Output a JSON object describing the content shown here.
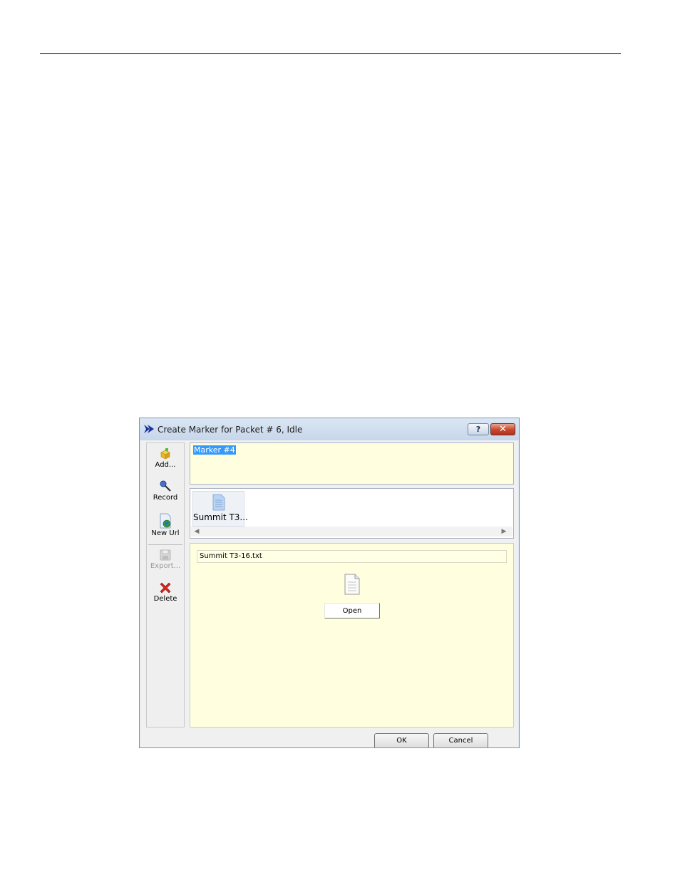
{
  "dialog": {
    "title": "Create Marker for Packet # 6, Idle",
    "help_label": "?",
    "close_label": "✕"
  },
  "toolbar": {
    "items": [
      {
        "label": "Add...",
        "icon": "add-icon",
        "enabled": true
      },
      {
        "label": "Record",
        "icon": "record-icon",
        "enabled": true
      },
      {
        "label": "New Url",
        "icon": "new-url-icon",
        "enabled": true
      },
      {
        "label": "Export...",
        "icon": "export-icon",
        "enabled": false
      },
      {
        "label": "Delete",
        "icon": "delete-icon",
        "enabled": true
      }
    ]
  },
  "marker": {
    "name": "Marker #4"
  },
  "attachments": {
    "items": [
      {
        "label": "Summit T3..."
      }
    ]
  },
  "detail": {
    "filename": "Summit T3-16.txt",
    "open_label": "Open"
  },
  "footer": {
    "ok_label": "OK",
    "cancel_label": "Cancel"
  }
}
